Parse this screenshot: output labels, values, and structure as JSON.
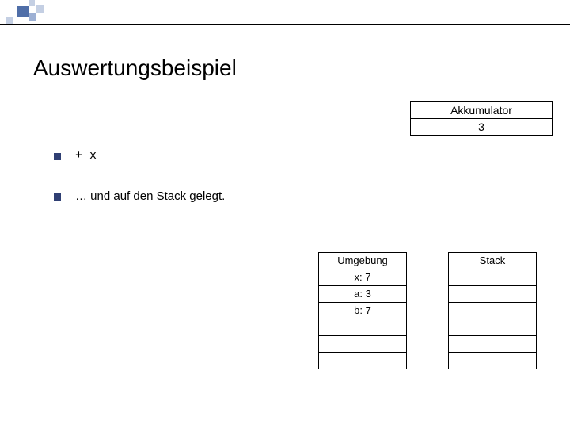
{
  "title": "Auswertungsbeispiel",
  "akk": {
    "label": "Akkumulator",
    "value": "3"
  },
  "bullets": [
    {
      "kind": "code",
      "text": "+ x"
    },
    {
      "kind": "text",
      "text": "… und auf den Stack gelegt."
    }
  ],
  "umgebung": {
    "header": "Umgebung",
    "rows": [
      "x: 7",
      "a: 3",
      "b: 7",
      "",
      "",
      ""
    ]
  },
  "stack": {
    "header": "Stack",
    "rows": [
      "",
      "",
      "",
      "",
      "",
      ""
    ]
  }
}
